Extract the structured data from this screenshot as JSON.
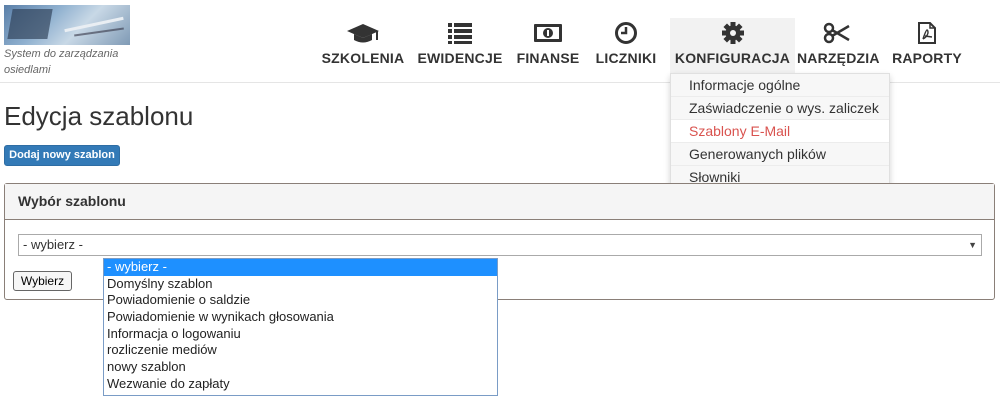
{
  "app": {
    "subtitle": "System do zarządzania osiedlami"
  },
  "nav": {
    "items": [
      {
        "label": "SZKOLENIA",
        "icon": "graduation-cap-icon"
      },
      {
        "label": "EWIDENCJE",
        "icon": "list-icon"
      },
      {
        "label": "FINANSE",
        "icon": "banknote-icon"
      },
      {
        "label": "LICZNIKI",
        "icon": "clock-icon"
      },
      {
        "label": "KONFIGURACJA",
        "icon": "gear-icon"
      },
      {
        "label": "NARZĘDZIA",
        "icon": "scissors-icon"
      },
      {
        "label": "RAPORTY",
        "icon": "pdf-file-icon"
      }
    ],
    "active": "KONFIGURACJA"
  },
  "config_menu": {
    "items": [
      "Informacje ogólne",
      "Zaświadczenie o wys. zaliczek",
      "Szablony E-Mail",
      "Generowanych plików",
      "Słowniki"
    ],
    "highlighted": "Szablony E-Mail",
    "highlight_color": "#d9534f"
  },
  "page": {
    "title": "Edycja szablonu",
    "add_button": "Dodaj nowy szablon"
  },
  "panel": {
    "title": "Wybór szablonu",
    "select_value": "- wybierz -",
    "submit_button": "Wybierz",
    "options": [
      "- wybierz -",
      "Domyślny szablon",
      "Powiadomienie o saldzie",
      "Powiadomienie w wynikach głosowania",
      "Informacja o logowaniu",
      "rozliczenie mediów",
      "nowy szablon",
      "Wezwanie do zapłaty"
    ],
    "selected_option": "- wybierz -"
  },
  "colors": {
    "primary": "#337ab7",
    "selection": "#1e90ff"
  }
}
